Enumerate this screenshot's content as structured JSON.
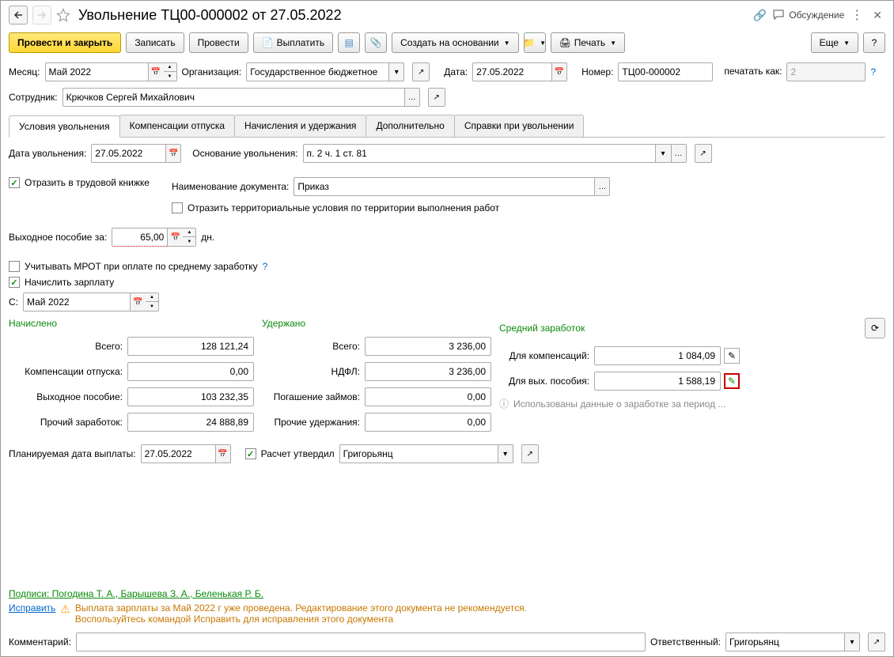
{
  "header": {
    "title": "Увольнение ТЦ00-000002 от 27.05.2022",
    "discussion": "Обсуждение"
  },
  "toolbar": {
    "post_close": "Провести и закрыть",
    "save": "Записать",
    "post": "Провести",
    "pay": "Выплатить",
    "create_based": "Создать на основании",
    "print": "Печать",
    "more": "Еще"
  },
  "fields": {
    "month_lbl": "Месяц:",
    "month": "Май 2022",
    "org_lbl": "Организация:",
    "org": "Государственное бюджетное",
    "date_lbl": "Дата:",
    "date": "27.05.2022",
    "number_lbl": "Номер:",
    "number": "ТЦ00-000002",
    "print_as_lbl": "печатать как:",
    "print_as": "2",
    "employee_lbl": "Сотрудник:",
    "employee": "Крючков Сергей Михайлович"
  },
  "tabs": {
    "t1": "Условия увольнения",
    "t2": "Компенсации отпуска",
    "t3": "Начисления и удержания",
    "t4": "Дополнительно",
    "t5": "Справки при увольнении"
  },
  "main": {
    "dismiss_date_lbl": "Дата увольнения:",
    "dismiss_date": "27.05.2022",
    "basis_lbl": "Основание увольнения:",
    "basis": "п. 2 ч. 1 ст. 81",
    "workbook_chk": "Отразить в трудовой книжке",
    "docname_lbl": "Наименование документа:",
    "docname": "Приказ",
    "territory_chk": "Отразить территориальные условия по территории выполнения работ",
    "severance_lbl": "Выходное пособие за:",
    "severance_days": "65,00",
    "days_unit": "дн.",
    "mrot_chk": "Учитывать МРОТ при оплате по среднему заработку",
    "payroll_chk": "Начислить зарплату",
    "from_lbl": "С:",
    "from": "Май 2022"
  },
  "calc": {
    "accrued_h": "Начислено",
    "withheld_h": "Удержано",
    "average_h": "Средний заработок",
    "total_lbl": "Всего:",
    "total_acc": "128 121,24",
    "comp_lbl": "Компенсации отпуска:",
    "comp": "0,00",
    "sev_lbl": "Выходное пособие:",
    "sev": "103 232,35",
    "other_lbl": "Прочий заработок:",
    "other": "24 888,89",
    "total_wh": "3 236,00",
    "ndfl_lbl": "НДФЛ:",
    "ndfl": "3 236,00",
    "loan_lbl": "Погашение займов:",
    "loan": "0,00",
    "other_wh_lbl": "Прочие удержания:",
    "other_wh": "0,00",
    "avg_comp_lbl": "Для компенсаций:",
    "avg_comp": "1 084,09",
    "avg_sev_lbl": "Для вых. пособия:",
    "avg_sev": "1 588,19",
    "avg_info": "Использованы данные о заработке за период ..."
  },
  "payment": {
    "pay_date_lbl": "Планируемая дата выплаты:",
    "pay_date": "27.05.2022",
    "verified_lbl": "Расчет утвердил",
    "verified_by": "Григорьянц"
  },
  "footer": {
    "signatures": "Подписи: Погодина Т. А., Барышева З. А., Беленькая Р. Б.",
    "fix": "Исправить",
    "warn1": "Выплата зарплаты за Май 2022 г уже проведена. Редактирование этого документа не рекомендуется.",
    "warn2": "Воспользуйтесь командой Исправить для исправления этого документа",
    "comment_lbl": "Комментарий:",
    "responsible_lbl": "Ответственный:",
    "responsible": "Григорьянц"
  }
}
